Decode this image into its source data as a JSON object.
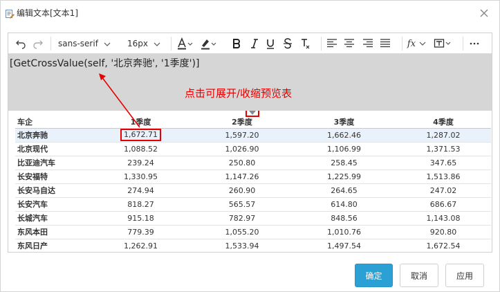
{
  "window": {
    "title": "编辑文本[文本1]"
  },
  "toolbar": {
    "font_family": "sans-serif",
    "font_size": "16px",
    "icons": [
      "undo-icon",
      "redo-icon",
      "font-color-icon",
      "highlight-icon",
      "bold-icon",
      "italic-icon",
      "underline-icon",
      "strikethrough-icon",
      "clear-format-icon",
      "align-left-icon",
      "align-center-icon",
      "align-right-icon",
      "align-justify-icon",
      "formula-icon",
      "insert-field-icon",
      "more-icon"
    ],
    "formula_label": "fx"
  },
  "editor": {
    "formula": "[GetCrossValue(self, '北京奔驰', '1季度')]",
    "annotation": "点击可展开/收缩预览表"
  },
  "preview_table": {
    "columns": [
      "车企",
      "1季度",
      "2季度",
      "3季度",
      "4季度"
    ],
    "rows": [
      [
        "北京奔驰",
        "1,672.71",
        "1,597.20",
        "1,662.46",
        "1,287.02"
      ],
      [
        "北京现代",
        "1,088.52",
        "1,026.90",
        "1,106.99",
        "1,371.53"
      ],
      [
        "比亚迪汽车",
        "239.24",
        "250.80",
        "258.45",
        "347.65"
      ],
      [
        "长安福特",
        "1,330.95",
        "1,147.26",
        "1,225.99",
        "1,513.86"
      ],
      [
        "长安马自达",
        "274.94",
        "260.90",
        "264.65",
        "247.02"
      ],
      [
        "长安汽车",
        "818.27",
        "565.57",
        "614.80",
        "686.67"
      ],
      [
        "长城汽车",
        "915.18",
        "782.97",
        "848.56",
        "1,143.08"
      ],
      [
        "东风本田",
        "779.39",
        "1,055.20",
        "1,010.76",
        "920.80"
      ],
      [
        "东风日产",
        "1,262.91",
        "1,533.94",
        "1,497.54",
        "1,672.54"
      ]
    ]
  },
  "buttons": {
    "ok": "确定",
    "cancel": "取消",
    "apply": "应用"
  },
  "colors": {
    "accent": "#2aa0d4",
    "annotation": "#e60000",
    "editor_bg": "#d6d6d6",
    "selected_row": "#e9f1fb"
  }
}
